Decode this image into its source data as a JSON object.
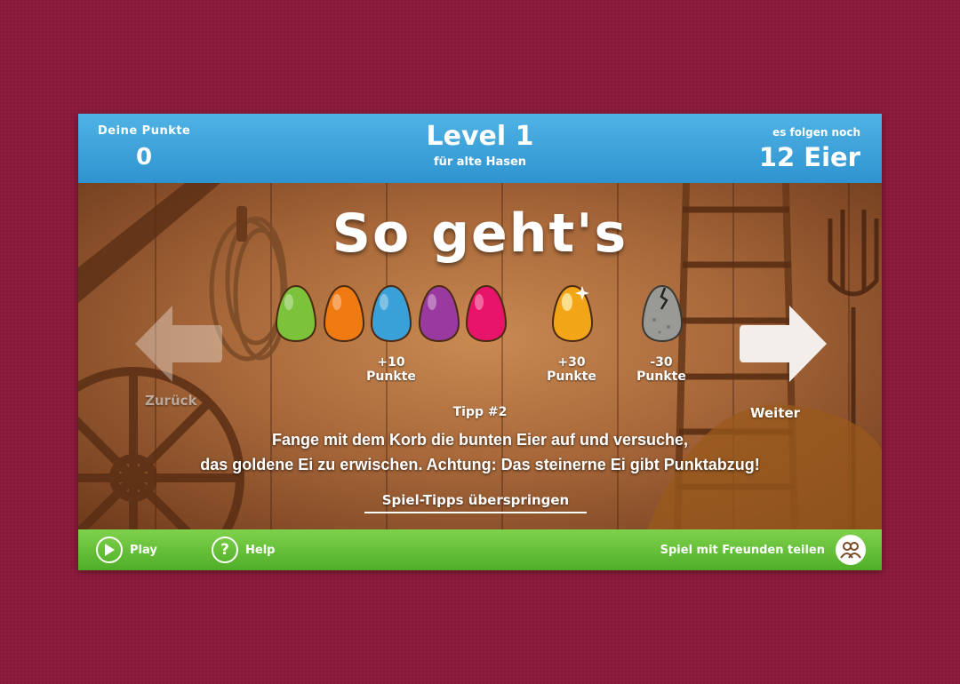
{
  "header": {
    "score_label": "Deine Punkte",
    "score_value": "0",
    "level_title": "Level 1",
    "level_subtitle": "für alte Hasen",
    "remaining_label": "es folgen noch",
    "remaining_value": "12 Eier"
  },
  "main": {
    "title": "So geht's",
    "eggs": [
      {
        "name": "green",
        "color": "#7cc23a"
      },
      {
        "name": "orange",
        "color": "#f07a12"
      },
      {
        "name": "blue",
        "color": "#3aa0d8"
      },
      {
        "name": "purple",
        "color": "#9a3aa0"
      },
      {
        "name": "pink",
        "color": "#e8146a"
      },
      {
        "name": "golden",
        "color": "#f2a516"
      },
      {
        "name": "stone",
        "color": "#9a9a94"
      }
    ],
    "points": {
      "normal": [
        "+10",
        "Punkte"
      ],
      "golden": [
        "+30",
        "Punkte"
      ],
      "stone": [
        "-30",
        "Punkte"
      ]
    },
    "back_label": "Zurück",
    "next_label": "Weiter",
    "tip_heading": "Tipp #2",
    "tip_line1": "Fange mit dem Korb die bunten Eier auf und versuche,",
    "tip_line2": "das goldene Ei zu erwischen. Achtung: Das steinerne Ei gibt Punktabzug!",
    "skip_label": "Spiel-Tipps überspringen"
  },
  "footer": {
    "play_label": "Play",
    "help_label": "Help",
    "help_icon": "?",
    "share_label": "Spiel mit Freunden teilen"
  }
}
